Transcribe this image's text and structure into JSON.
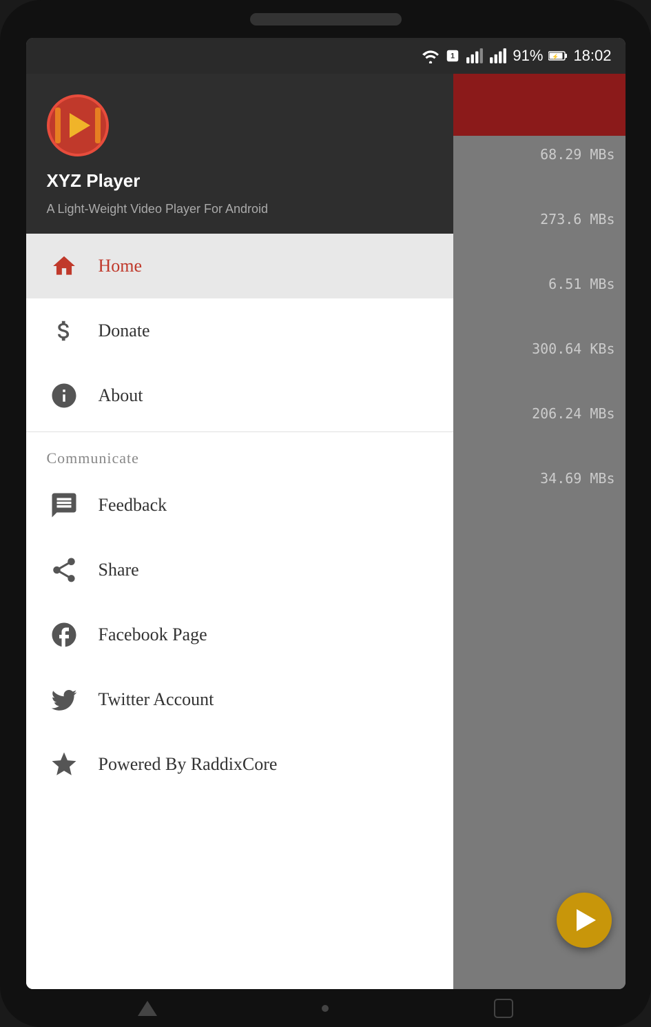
{
  "statusBar": {
    "time": "18:02",
    "battery": "91%",
    "batteryCharging": true
  },
  "app": {
    "name": "XYZ Player",
    "subtitle": "A Light-Weight Video Player For Android"
  },
  "menu": {
    "items": [
      {
        "id": "home",
        "label": "Home",
        "active": true,
        "icon": "home-icon"
      },
      {
        "id": "donate",
        "label": "Donate",
        "active": false,
        "icon": "dollar-icon"
      },
      {
        "id": "about",
        "label": "About",
        "active": false,
        "icon": "info-icon"
      }
    ],
    "sections": [
      {
        "id": "communicate",
        "label": "Communicate",
        "items": [
          {
            "id": "feedback",
            "label": "Feedback",
            "active": false,
            "icon": "feedback-icon"
          },
          {
            "id": "share",
            "label": "Share",
            "active": false,
            "icon": "share-icon"
          },
          {
            "id": "facebook",
            "label": "Facebook Page",
            "active": false,
            "icon": "facebook-icon"
          },
          {
            "id": "twitter",
            "label": "Twitter Account",
            "active": false,
            "icon": "twitter-icon"
          },
          {
            "id": "powered",
            "label": "Powered By RaddixCore",
            "active": false,
            "icon": "star-icon"
          }
        ]
      }
    ]
  },
  "rightPanel": {
    "sizes": [
      "68.29 MBs",
      "273.6 MBs",
      "6.51 MBs",
      "300.64 KBs",
      "206.24 MBs",
      "34.69 MBs"
    ]
  }
}
